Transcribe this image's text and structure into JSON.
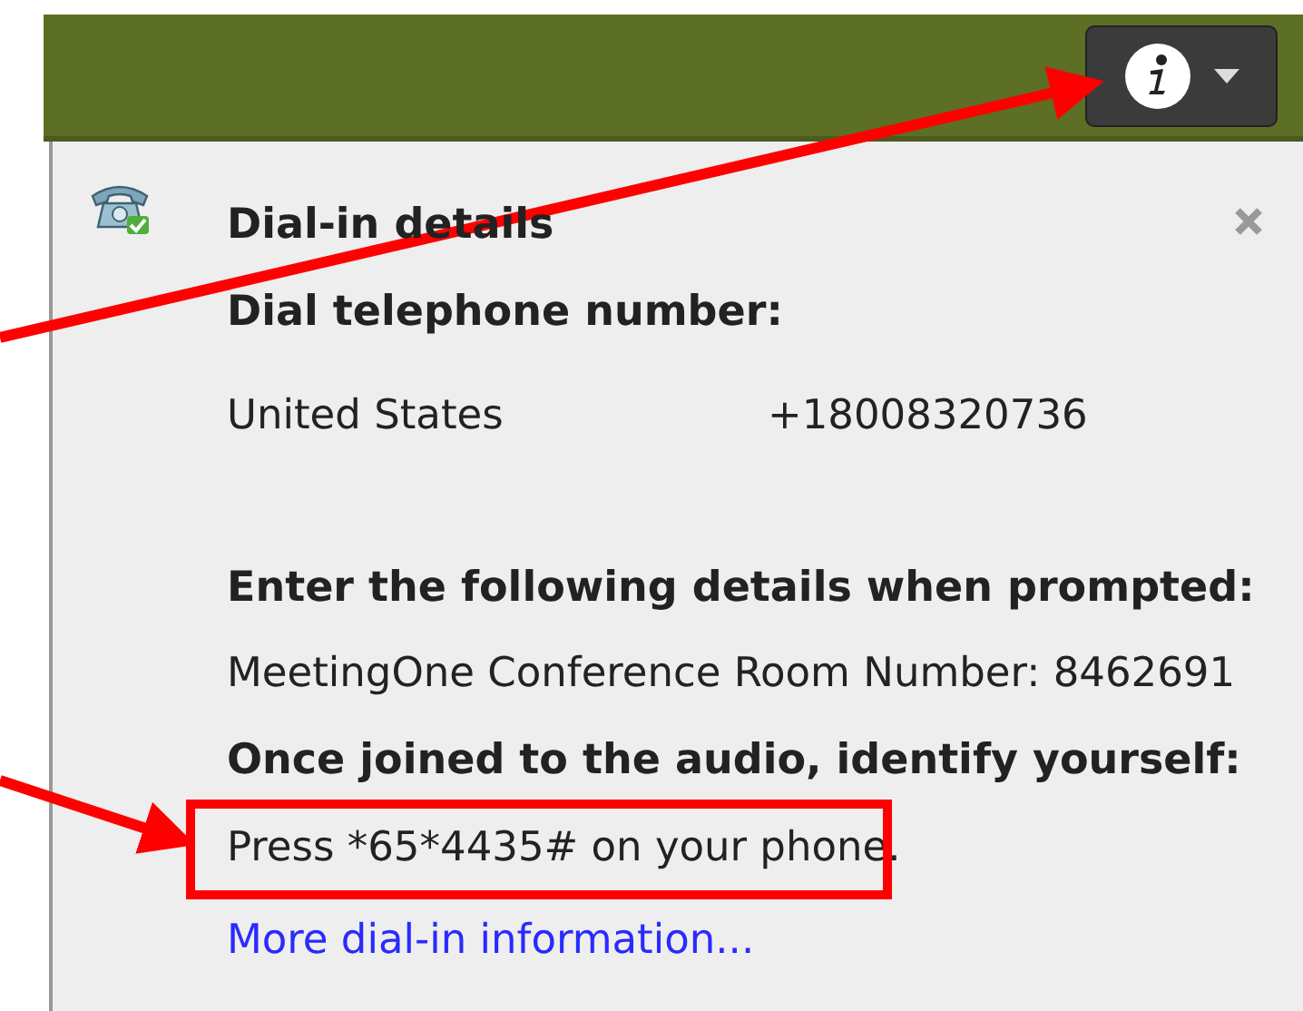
{
  "panel": {
    "title": "Dial-in details",
    "heading": "Dial telephone number:",
    "numbers": [
      {
        "country": "United States",
        "number": "+18008320736"
      }
    ],
    "prompt_heading": "Enter the following details when prompted:",
    "prompt_detail": "MeetingOne Conference Room Number: 8462691",
    "identify_heading": "Once joined to the audio, identify yourself:",
    "identify_detail": "Press *65*4435# on your phone.",
    "link": "More dial-in information..."
  }
}
